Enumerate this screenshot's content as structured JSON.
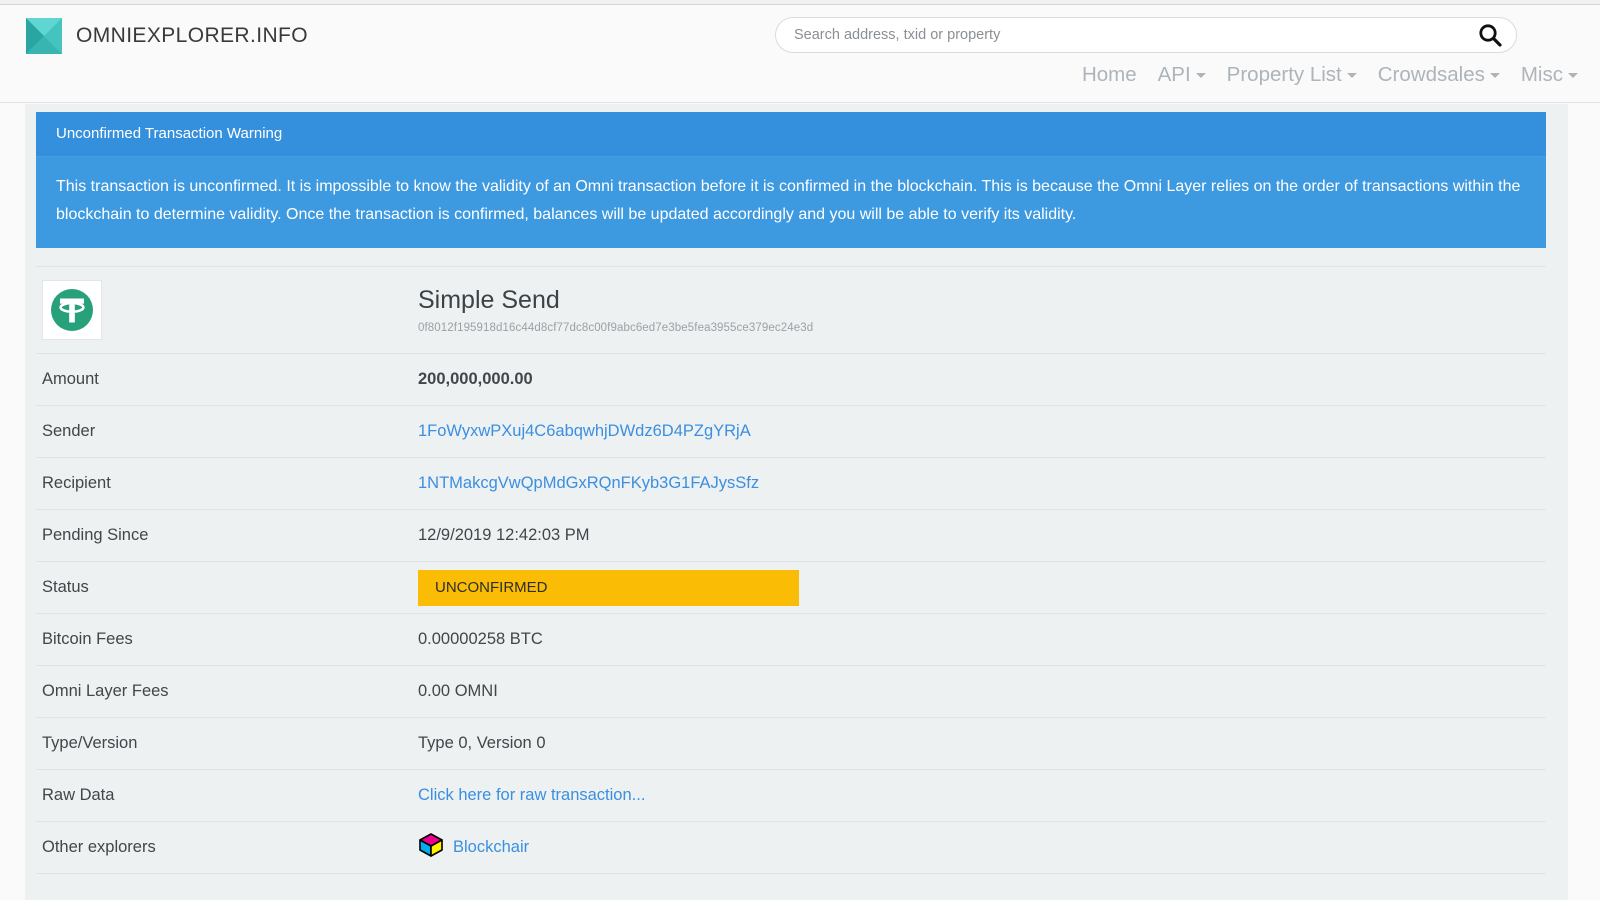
{
  "header": {
    "brand_name": "OMNIEXPLORER.INFO",
    "logo_icon": "omni-pyramid-logo-icon",
    "search": {
      "placeholder": "Search address, txid or property",
      "value": "",
      "icon": "search-icon"
    },
    "nav": [
      {
        "label": "Home",
        "has_caret": false
      },
      {
        "label": "API",
        "has_caret": true
      },
      {
        "label": "Property List",
        "has_caret": true
      },
      {
        "label": "Crowdsales",
        "has_caret": true
      },
      {
        "label": "Misc",
        "has_caret": true
      }
    ]
  },
  "alert": {
    "title": "Unconfirmed Transaction Warning",
    "body": "This transaction is unconfirmed. It is impossible to know the validity of an Omni transaction before it is confirmed in the blockchain. This is because the Omni Layer relies on the order of transactions within the blockchain to determine validity. Once the transaction is confirmed, balances will be updated accordingly and you will be able to verify its validity.",
    "header_color": "#3490dc",
    "body_color": "#3d99e0"
  },
  "transaction": {
    "coin_icon": "tether-usdt-icon",
    "type_title": "Simple Send",
    "txid": "0f8012f195918d16c44d8cf77dc8c00f9abc6ed7e3be5fea3955ce379ec24e3d",
    "rows": [
      {
        "label": "Amount",
        "value": "200,000,000.00",
        "style": "bold"
      },
      {
        "label": "Sender",
        "value": "1FoWyxwPXuj4C6abqwhjDWdz6D4PZgYRjA",
        "style": "link"
      },
      {
        "label": "Recipient",
        "value": "1NTMakcgVwQpMdGxRQnFKyb3G1FAJysSfz",
        "style": "link"
      },
      {
        "label": "Pending Since",
        "value": "12/9/2019 12:42:03 PM",
        "style": "plain"
      },
      {
        "label": "Status",
        "value": "UNCONFIRMED",
        "style": "badge"
      },
      {
        "label": "Bitcoin Fees",
        "value": "0.00000258 BTC",
        "style": "plain"
      },
      {
        "label": "Omni Layer Fees",
        "value": "0.00 OMNI",
        "style": "plain"
      },
      {
        "label": "Type/Version",
        "value": "Type 0, Version 0",
        "style": "plain"
      },
      {
        "label": "Raw Data",
        "value": "Click here for raw transaction...",
        "style": "link"
      },
      {
        "label": "Other explorers",
        "value": "Blockchair",
        "style": "explorer"
      }
    ],
    "status_badge_color": "#fbbc05",
    "explorer_icon": "blockchair-cube-icon"
  }
}
